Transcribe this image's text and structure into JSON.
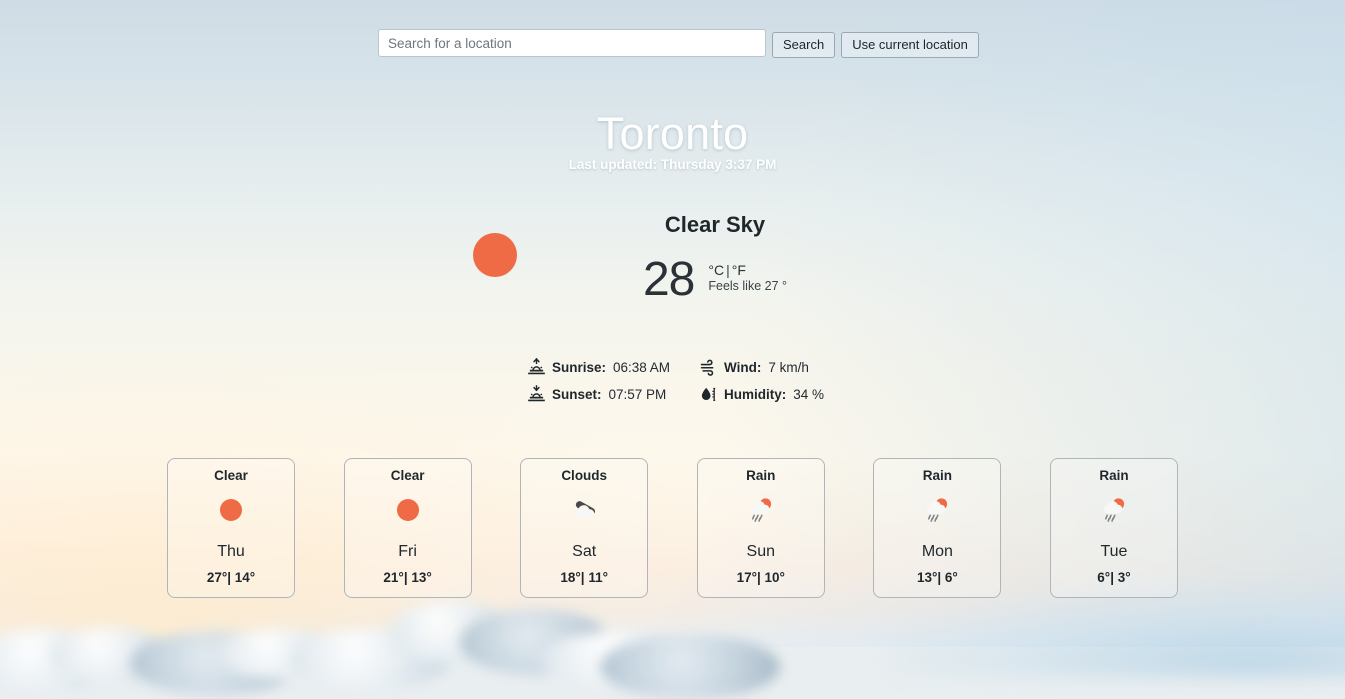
{
  "search": {
    "placeholder": "Search for a location",
    "value": "",
    "search_label": "Search",
    "geolocate_label": "Use current location"
  },
  "header": {
    "city": "Toronto",
    "last_updated": "Last updated: Thursday 3:37 PM"
  },
  "current": {
    "condition": "Clear Sky",
    "icon": "sun-icon",
    "temperature": "28",
    "unit_celsius": "°C",
    "unit_separator": "|",
    "unit_fahrenheit": "°F",
    "feels_like": "Feels like 27 °"
  },
  "details": [
    {
      "icon": "sunrise-icon",
      "label": "Sunrise:",
      "value": "06:38 AM"
    },
    {
      "icon": "wind-icon",
      "label": "Wind:",
      "value": "7 km/h"
    },
    {
      "icon": "sunset-icon",
      "label": "Sunset:",
      "value": "07:57 PM"
    },
    {
      "icon": "humidity-icon",
      "label": "Humidity:",
      "value": "34 %"
    }
  ],
  "forecast": [
    {
      "condition": "Clear",
      "icon": "sun-icon",
      "day": "Thu",
      "temps": "27°| 14°"
    },
    {
      "condition": "Clear",
      "icon": "sun-icon",
      "day": "Fri",
      "temps": "21°| 13°"
    },
    {
      "condition": "Clouds",
      "icon": "clouds-icon",
      "day": "Sat",
      "temps": "18°| 11°"
    },
    {
      "condition": "Rain",
      "icon": "sun-rain-icon",
      "day": "Sun",
      "temps": "17°| 10°"
    },
    {
      "condition": "Rain",
      "icon": "sun-rain-icon",
      "day": "Mon",
      "temps": "13°| 6°"
    },
    {
      "condition": "Rain",
      "icon": "sun-rain-icon",
      "day": "Tue",
      "temps": "6°| 3°"
    }
  ],
  "colors": {
    "sun": "#ef6b45",
    "sky_top": "#cfdce5",
    "sky_bottom": "#fdf6ea",
    "text": "#1f272c"
  }
}
